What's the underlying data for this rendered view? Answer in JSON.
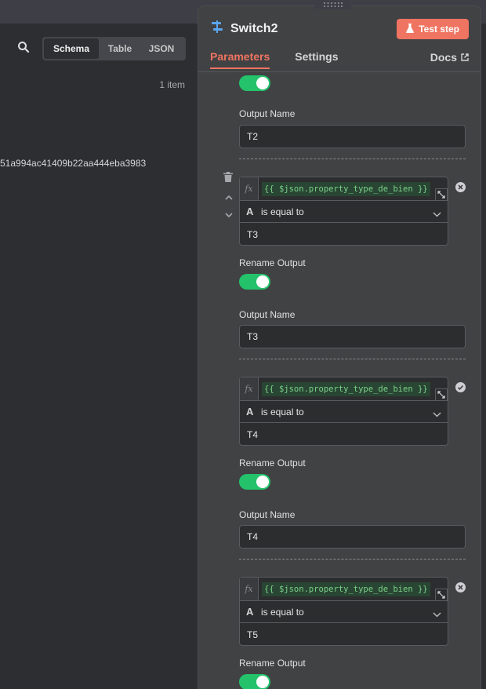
{
  "input_panel": {
    "views": [
      "Schema",
      "Table",
      "JSON"
    ],
    "active_view": "Schema",
    "item_count": "1 item",
    "visible_value": "51a994ac41409b22aa444eba3983"
  },
  "node": {
    "title": "Switch2",
    "test_button": "Test step",
    "tabs": [
      "Parameters",
      "Settings"
    ],
    "active_tab": "Parameters",
    "docs_label": "Docs"
  },
  "labels": {
    "output_name": "Output Name",
    "rename_output": "Rename Output"
  },
  "rules": [
    {
      "output_name": "T2"
    },
    {
      "expression": "{{ $json.property_type_de_bien }}",
      "operator_icon": "A",
      "operator": "is equal to",
      "value": "T3",
      "rename_output_on": true,
      "output_name": "T3"
    },
    {
      "expression": "{{ $json.property_type_de_bien }}",
      "operator_icon": "A",
      "operator": "is equal to",
      "value": "T4",
      "rename_output_on": true,
      "output_name": "T4"
    },
    {
      "expression": "{{ $json.property_type_de_bien }}",
      "operator_icon": "A",
      "operator": "is equal to",
      "value": "T5",
      "rename_output_on": true
    }
  ],
  "colors": {
    "accent": "#ef7461",
    "toggle_on": "#23c26b",
    "expression_bg": "#294533",
    "expression_text": "#7bd38a",
    "panel_bg": "#414244",
    "canvas_bg": "#2d2e32"
  }
}
